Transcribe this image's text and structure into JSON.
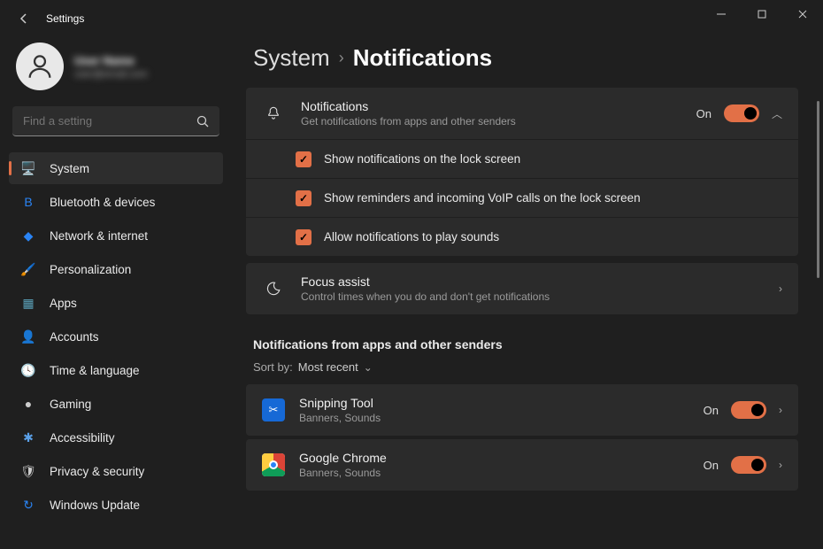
{
  "titlebar": {
    "title": "Settings"
  },
  "profile": {
    "name": "User Name",
    "email": "user@email.com"
  },
  "search": {
    "placeholder": "Find a setting"
  },
  "nav": {
    "items": [
      {
        "label": "System",
        "icon": "🖥️",
        "iconName": "display-icon"
      },
      {
        "label": "Bluetooth & devices",
        "icon": "B",
        "iconName": "bluetooth-icon",
        "iconColor": "#2a84f5"
      },
      {
        "label": "Network & internet",
        "icon": "◆",
        "iconName": "wifi-icon",
        "iconColor": "#2a84f5"
      },
      {
        "label": "Personalization",
        "icon": "🖌️",
        "iconName": "paintbrush-icon"
      },
      {
        "label": "Apps",
        "icon": "▦",
        "iconName": "apps-icon",
        "iconColor": "#5aa0b8"
      },
      {
        "label": "Accounts",
        "icon": "👤",
        "iconName": "person-icon",
        "iconColor": "#3aa455"
      },
      {
        "label": "Time & language",
        "icon": "🕓",
        "iconName": "clock-icon"
      },
      {
        "label": "Gaming",
        "icon": "●",
        "iconName": "gamepad-icon"
      },
      {
        "label": "Accessibility",
        "icon": "✱",
        "iconName": "accessibility-icon",
        "iconColor": "#5aa0e8"
      },
      {
        "label": "Privacy & security",
        "icon": "🛡",
        "iconName": "shield-icon"
      },
      {
        "label": "Windows Update",
        "icon": "↻",
        "iconName": "update-icon",
        "iconColor": "#2a84f5"
      }
    ]
  },
  "breadcrumb": {
    "parent": "System",
    "current": "Notifications"
  },
  "notifications_card": {
    "title": "Notifications",
    "subtitle": "Get notifications from apps and other senders",
    "state": "On",
    "checks": [
      "Show notifications on the lock screen",
      "Show reminders and incoming VoIP calls on the lock screen",
      "Allow notifications to play sounds"
    ]
  },
  "focus_card": {
    "title": "Focus assist",
    "subtitle": "Control times when you do and don't get notifications"
  },
  "apps_section": {
    "title": "Notifications from apps and other senders",
    "sort_label": "Sort by:",
    "sort_value": "Most recent",
    "items": [
      {
        "name": "Snipping Tool",
        "sub": "Banners, Sounds",
        "state": "On",
        "iconClass": "snip"
      },
      {
        "name": "Google Chrome",
        "sub": "Banners, Sounds",
        "state": "On",
        "iconClass": "chrome"
      }
    ]
  }
}
